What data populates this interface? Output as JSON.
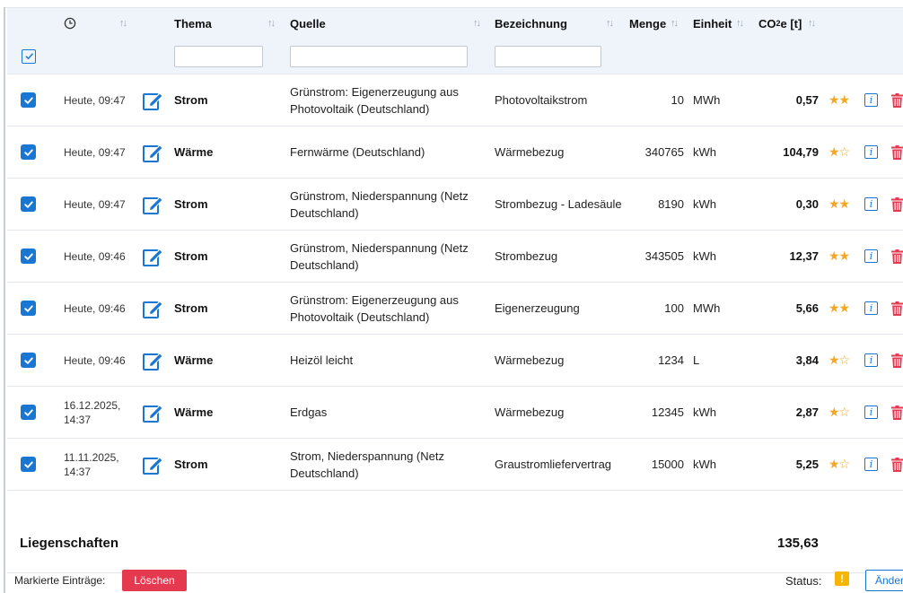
{
  "table": {
    "headers": {
      "time_sort": "↑↓",
      "thema": "Thema",
      "quelle": "Quelle",
      "bezeichnung": "Bezeichnung",
      "menge": "Menge",
      "einheit": "Einheit",
      "co2_prefix": "CO",
      "co2_sub": "2",
      "co2_suffix": "e [t]",
      "sort": "↑↓"
    },
    "filter_inputs": [
      {
        "name": "thema-filter",
        "value": ""
      },
      {
        "name": "quelle-filter",
        "value": ""
      },
      {
        "name": "bezeichnung-filter",
        "value": ""
      }
    ],
    "rows": [
      {
        "date": "Heute, 09:47",
        "thema": "Strom",
        "quelle": "Grünstrom: Eigenerzeugung aus Photovoltaik (Deutschland)",
        "bezeichnung": "Photovoltaikstrom",
        "menge": "10",
        "einheit": "MWh",
        "co2": "0,57",
        "stars": "★★"
      },
      {
        "date": "Heute, 09:47",
        "thema": "Wärme",
        "quelle": "Fernwärme (Deutschland)",
        "bezeichnung": "Wärmebezug",
        "menge": "340765",
        "einheit": "kWh",
        "co2": "104,79",
        "stars": "★☆"
      },
      {
        "date": "Heute, 09:47",
        "thema": "Strom",
        "quelle": "Grünstrom, Niederspannung (Netz Deutschland)",
        "bezeichnung": "Strombezug - Ladesäule",
        "menge": "8190",
        "einheit": "kWh",
        "co2": "0,30",
        "stars": "★★"
      },
      {
        "date": "Heute, 09:46",
        "thema": "Strom",
        "quelle": "Grünstrom, Niederspannung (Netz Deutschland)",
        "bezeichnung": "Strombezug",
        "menge": "343505",
        "einheit": "kWh",
        "co2": "12,37",
        "stars": "★★"
      },
      {
        "date": "Heute, 09:46",
        "thema": "Strom",
        "quelle": "Grünstrom: Eigenerzeugung aus Photovoltaik (Deutschland)",
        "bezeichnung": "Eigenerzeugung",
        "menge": "100",
        "einheit": "MWh",
        "co2": "5,66",
        "stars": "★★"
      },
      {
        "date": "Heute, 09:46",
        "thema": "Wärme",
        "quelle": "Heizöl leicht",
        "bezeichnung": "Wärmebezug",
        "menge": "1234",
        "einheit": "L",
        "co2": "3,84",
        "stars": "★☆"
      },
      {
        "date": "16.12.2025, 14:37",
        "thema": "Wärme",
        "quelle": "Erdgas",
        "bezeichnung": "Wärmebezug",
        "menge": "12345",
        "einheit": "kWh",
        "co2": "2,87",
        "stars": "★☆"
      },
      {
        "date": "11.11.2025, 14:37",
        "thema": "Strom",
        "quelle": "Strom, Niederspannung (Netz Deutschland)",
        "bezeichnung": "Graustromliefervertrag",
        "menge": "15000",
        "einheit": "kWh",
        "co2": "5,25",
        "stars": "★☆"
      }
    ],
    "info_glyph": "i"
  },
  "total": {
    "label": "Liegenschaften",
    "value": "135,63"
  },
  "footer": {
    "marked_label": "Markierte Einträge:",
    "delete_button": "Löschen",
    "status_label": "Status:",
    "status_glyph": "!",
    "change_button": "Änderr"
  },
  "colors": {
    "accent": "#1976d2",
    "danger": "#e53950",
    "star": "#f5a623",
    "warning": "#f7b500",
    "header_bg": "#eef4fa"
  }
}
